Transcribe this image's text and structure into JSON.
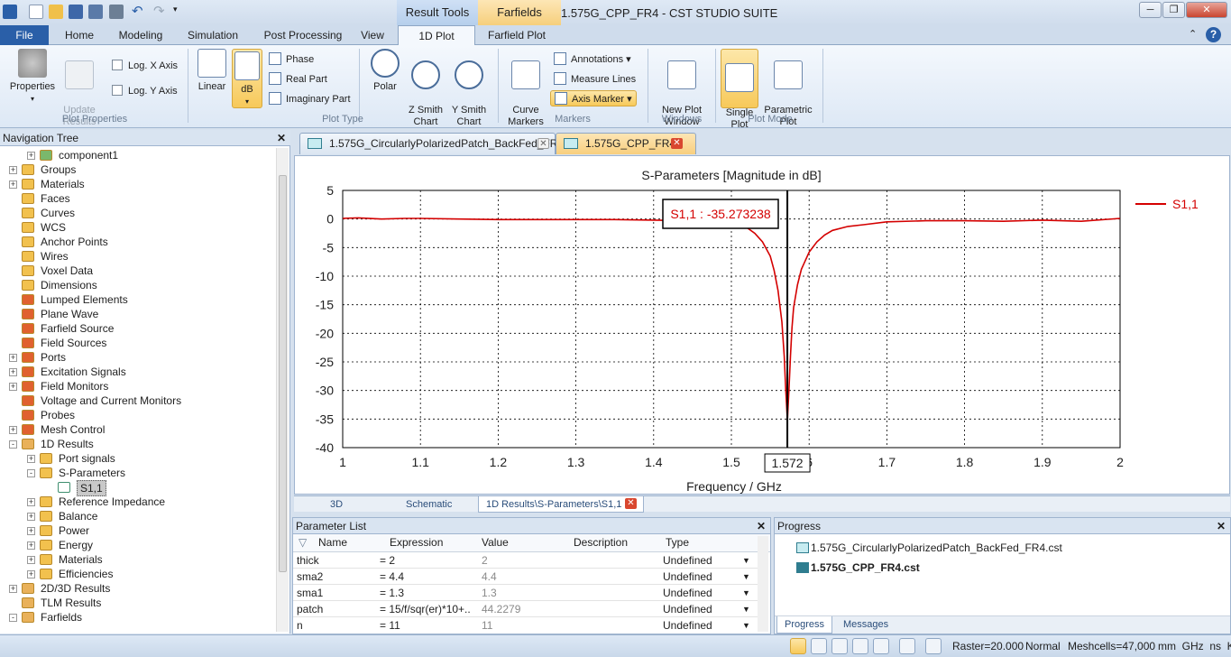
{
  "app": {
    "window_title": "1.575G_CPP_FR4 - CST STUDIO SUITE",
    "context_tabs": [
      "Result Tools",
      "Farfields"
    ]
  },
  "ribbon": {
    "tabs": [
      "File",
      "Home",
      "Modeling",
      "Simulation",
      "Post Processing",
      "View",
      "1D Plot",
      "Farfield Plot"
    ],
    "active_tab": "1D Plot",
    "plot_properties": {
      "properties_label": "Properties",
      "update_results_label": "Update\nResults",
      "log_x_label": "Log. X Axis",
      "log_y_label": "Log. Y Axis",
      "group_label": "Plot Properties"
    },
    "plot_type": {
      "linear_label": "Linear",
      "db_label": "dB",
      "phase_label": "Phase",
      "real_part_label": "Real Part",
      "imaginary_part_label": "Imaginary Part",
      "polar_label": "Polar",
      "z_smith_label": "Z Smith\nChart",
      "y_smith_label": "Y Smith\nChart",
      "group_label": "Plot Type"
    },
    "markers": {
      "curve_markers_label": "Curve\nMarkers",
      "annotations_label": "Annotations",
      "measure_lines_label": "Measure Lines",
      "axis_marker_label": "Axis Marker",
      "group_label": "Markers"
    },
    "windows": {
      "new_plot_window_label": "New Plot\nWindow",
      "group_label": "Windows"
    },
    "plot_mode": {
      "single_plot_label": "Single\nPlot",
      "parametric_plot_label": "Parametric\nPlot",
      "group_label": "Plot Mode"
    }
  },
  "nav_tree": {
    "title": "Navigation Tree",
    "items": [
      {
        "label": "component1",
        "level": 1,
        "icon": "component-icon",
        "exp": "+"
      },
      {
        "label": "Groups",
        "level": 0,
        "icon": "folder-icon",
        "exp": "+"
      },
      {
        "label": "Materials",
        "level": 0,
        "icon": "folder-icon",
        "exp": "+"
      },
      {
        "label": "Faces",
        "level": 0,
        "icon": "folder-icon",
        "exp": ""
      },
      {
        "label": "Curves",
        "level": 0,
        "icon": "folder-icon",
        "exp": ""
      },
      {
        "label": "WCS",
        "level": 0,
        "icon": "folder-icon",
        "exp": ""
      },
      {
        "label": "Anchor Points",
        "level": 0,
        "icon": "folder-icon",
        "exp": ""
      },
      {
        "label": "Wires",
        "level": 0,
        "icon": "folder-icon",
        "exp": ""
      },
      {
        "label": "Voxel Data",
        "level": 0,
        "icon": "folder-icon",
        "exp": ""
      },
      {
        "label": "Dimensions",
        "level": 0,
        "icon": "folder-icon",
        "exp": ""
      },
      {
        "label": "Lumped Elements",
        "level": 0,
        "icon": "gear-folder-icon",
        "exp": ""
      },
      {
        "label": "Plane Wave",
        "level": 0,
        "icon": "gear-folder-icon",
        "exp": ""
      },
      {
        "label": "Farfield Source",
        "level": 0,
        "icon": "gear-folder-icon",
        "exp": ""
      },
      {
        "label": "Field Sources",
        "level": 0,
        "icon": "gear-folder-icon",
        "exp": ""
      },
      {
        "label": "Ports",
        "level": 0,
        "icon": "gear-folder-icon",
        "exp": "+"
      },
      {
        "label": "Excitation Signals",
        "level": 0,
        "icon": "gear-folder-icon",
        "exp": "+"
      },
      {
        "label": "Field Monitors",
        "level": 0,
        "icon": "gear-folder-icon",
        "exp": "+"
      },
      {
        "label": "Voltage and Current Monitors",
        "level": 0,
        "icon": "gear-folder-icon",
        "exp": ""
      },
      {
        "label": "Probes",
        "level": 0,
        "icon": "gear-folder-icon",
        "exp": ""
      },
      {
        "label": "Mesh Control",
        "level": 0,
        "icon": "gear-folder-icon",
        "exp": "+"
      },
      {
        "label": "1D Results",
        "level": 0,
        "icon": "results-folder-icon",
        "exp": "-"
      },
      {
        "label": "Port signals",
        "level": 1,
        "icon": "folder-icon",
        "exp": "+"
      },
      {
        "label": "S-Parameters",
        "level": 1,
        "icon": "folder-icon",
        "exp": "-"
      },
      {
        "label": "S1,1",
        "level": 2,
        "icon": "curve-icon",
        "exp": "",
        "selected": true
      },
      {
        "label": "Reference Impedance",
        "level": 1,
        "icon": "folder-icon",
        "exp": "+"
      },
      {
        "label": "Balance",
        "level": 1,
        "icon": "folder-icon",
        "exp": "+"
      },
      {
        "label": "Power",
        "level": 1,
        "icon": "folder-icon",
        "exp": "+"
      },
      {
        "label": "Energy",
        "level": 1,
        "icon": "folder-icon",
        "exp": "+"
      },
      {
        "label": "Materials",
        "level": 1,
        "icon": "folder-icon",
        "exp": "+"
      },
      {
        "label": "Efficiencies",
        "level": 1,
        "icon": "folder-icon",
        "exp": "+"
      },
      {
        "label": "2D/3D Results",
        "level": 0,
        "icon": "results-folder-icon",
        "exp": "+"
      },
      {
        "label": "TLM Results",
        "level": 0,
        "icon": "results-folder-icon",
        "exp": ""
      },
      {
        "label": "Farfields",
        "level": 0,
        "icon": "results-folder-icon",
        "exp": "-"
      }
    ]
  },
  "doc_tabs": [
    {
      "label": "1.575G_CircularlyPolarizedPatch_BackFed_FR4",
      "active": false
    },
    {
      "label": "1.575G_CPP_FR4*",
      "active": true
    }
  ],
  "chart_data": {
    "type": "line",
    "title": "S-Parameters [Magnitude in dB]",
    "xlabel": "Frequency / GHz",
    "ylabel": "",
    "xlim": [
      1,
      2
    ],
    "ylim": [
      -40,
      5
    ],
    "x_ticks": [
      "1",
      "1.1",
      "1.2",
      "1.3",
      "1.4",
      "1.5",
      "6",
      "1.7",
      "1.8",
      "1.9",
      "2"
    ],
    "y_ticks": [
      "5",
      "0",
      "-5",
      "-10",
      "-15",
      "-20",
      "-25",
      "-30",
      "-35",
      "-40"
    ],
    "grid": true,
    "legend_position": "right",
    "series": [
      {
        "name": "S1,1",
        "color": "#d40000",
        "x": [
          1.0,
          1.02,
          1.05,
          1.08,
          1.1,
          1.15,
          1.2,
          1.25,
          1.3,
          1.35,
          1.4,
          1.45,
          1.48,
          1.5,
          1.52,
          1.53,
          1.54,
          1.55,
          1.555,
          1.56,
          1.565,
          1.568,
          1.57,
          1.572,
          1.574,
          1.576,
          1.578,
          1.58,
          1.585,
          1.59,
          1.6,
          1.61,
          1.62,
          1.63,
          1.65,
          1.67,
          1.7,
          1.75,
          1.8,
          1.85,
          1.9,
          1.95,
          2.0
        ],
        "values": [
          0.1,
          0.2,
          0.0,
          0.1,
          0.1,
          0.0,
          -0.1,
          -0.1,
          -0.1,
          -0.1,
          -0.2,
          -0.3,
          -0.4,
          -0.6,
          -1.5,
          -2.5,
          -4.0,
          -6.5,
          -9.0,
          -12.5,
          -18.0,
          -24.0,
          -30.0,
          -35.27,
          -30.0,
          -24.0,
          -19.0,
          -15.5,
          -11.5,
          -8.8,
          -5.8,
          -4.0,
          -2.8,
          -2.0,
          -1.3,
          -1.0,
          -0.5,
          -0.3,
          -0.3,
          -0.4,
          -0.2,
          -0.4,
          0.1
        ]
      }
    ],
    "axis_marker": {
      "x": 1.572,
      "x_label": "1.572",
      "readout": "S1,1 : -35.273238"
    }
  },
  "view_tabs": [
    "3D",
    "Schematic",
    "1D Results\\S-Parameters\\S1,1"
  ],
  "parameter_list": {
    "title": "Parameter List",
    "columns": [
      "Name",
      "Expression",
      "Value",
      "Description",
      "Type"
    ],
    "rows": [
      {
        "name": "thick",
        "expression": "= 2",
        "value": "2",
        "description": "",
        "type": "Undefined"
      },
      {
        "name": "sma2",
        "expression": "= 4.4",
        "value": "4.4",
        "description": "",
        "type": "Undefined"
      },
      {
        "name": "sma1",
        "expression": "= 1.3",
        "value": "1.3",
        "description": "",
        "type": "Undefined"
      },
      {
        "name": "patch",
        "expression": "= 15/f/sqr(er)*10+...",
        "value": "44.2279",
        "description": "",
        "type": "Undefined"
      },
      {
        "name": "n",
        "expression": "= 11",
        "value": "11",
        "description": "",
        "type": "Undefined"
      }
    ]
  },
  "progress_panel": {
    "title": "Progress",
    "items": [
      {
        "label": "1.575G_CircularlyPolarizedPatch_BackFed_FR4.cst",
        "bold": false
      },
      {
        "label": "1.575G_CPP_FR4.cst",
        "bold": true
      }
    ],
    "tabs": [
      "Progress",
      "Messages"
    ]
  },
  "status_bar": {
    "raster": "Raster=20.000",
    "mode": "Normal",
    "meshcells": "Meshcells=47,000",
    "units": "mm  GHz  ns  K"
  }
}
